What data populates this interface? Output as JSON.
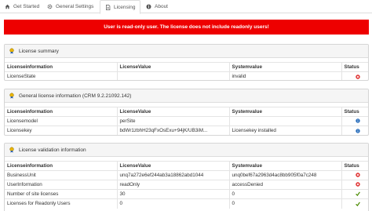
{
  "tabs": [
    {
      "label": "Get Started",
      "icon": "home-icon"
    },
    {
      "label": "General Settings",
      "icon": "gear-icon"
    },
    {
      "label": "Licensing",
      "icon": "document-icon",
      "active": true
    },
    {
      "label": "About",
      "icon": "info-icon"
    }
  ],
  "alert": {
    "text": "User is read-only user. The license does not include readonly users!",
    "color": "#ee0000"
  },
  "columns": {
    "info": "Licenseinformation",
    "value": "LicenseValue",
    "sysvalue": "Systemvalue",
    "status": "Status"
  },
  "summary": {
    "title": "License summary",
    "rows": [
      {
        "info": "LicenseState",
        "value": "",
        "sysvalue": "invalid",
        "status": "error"
      }
    ]
  },
  "general": {
    "title": "General license information (CRM 9.2.21092.142)",
    "rows": [
      {
        "info": "Licensemodel",
        "value": "perSite",
        "sysvalue": "",
        "status": "info"
      },
      {
        "info": "Licensekey",
        "value": "bdWr1zbhH23qFxOsExu+94jK/UB3iM...",
        "sysvalue": "Licensekey installed",
        "status": "info"
      }
    ]
  },
  "validation": {
    "title": "License validation information",
    "rows": [
      {
        "info": "BusinessUnit",
        "value": "unq7a272e6ef244ab3a18862abd1044",
        "sysvalue": "unq0bef67a2963d4ac8bb905f0a7c248",
        "status": "error"
      },
      {
        "info": "UserInformation",
        "value": "readOnly",
        "sysvalue": "accessDenied",
        "status": "error"
      },
      {
        "info": "Number of site licenses",
        "value": "30",
        "sysvalue": "0",
        "status": "ok"
      },
      {
        "info": "Licenses for Readonly Users",
        "value": "0",
        "sysvalue": "0",
        "status": "ok"
      }
    ]
  },
  "status_colors": {
    "error": "#dd2222",
    "info": "#2a6ebb",
    "ok": "#4a8a00"
  }
}
